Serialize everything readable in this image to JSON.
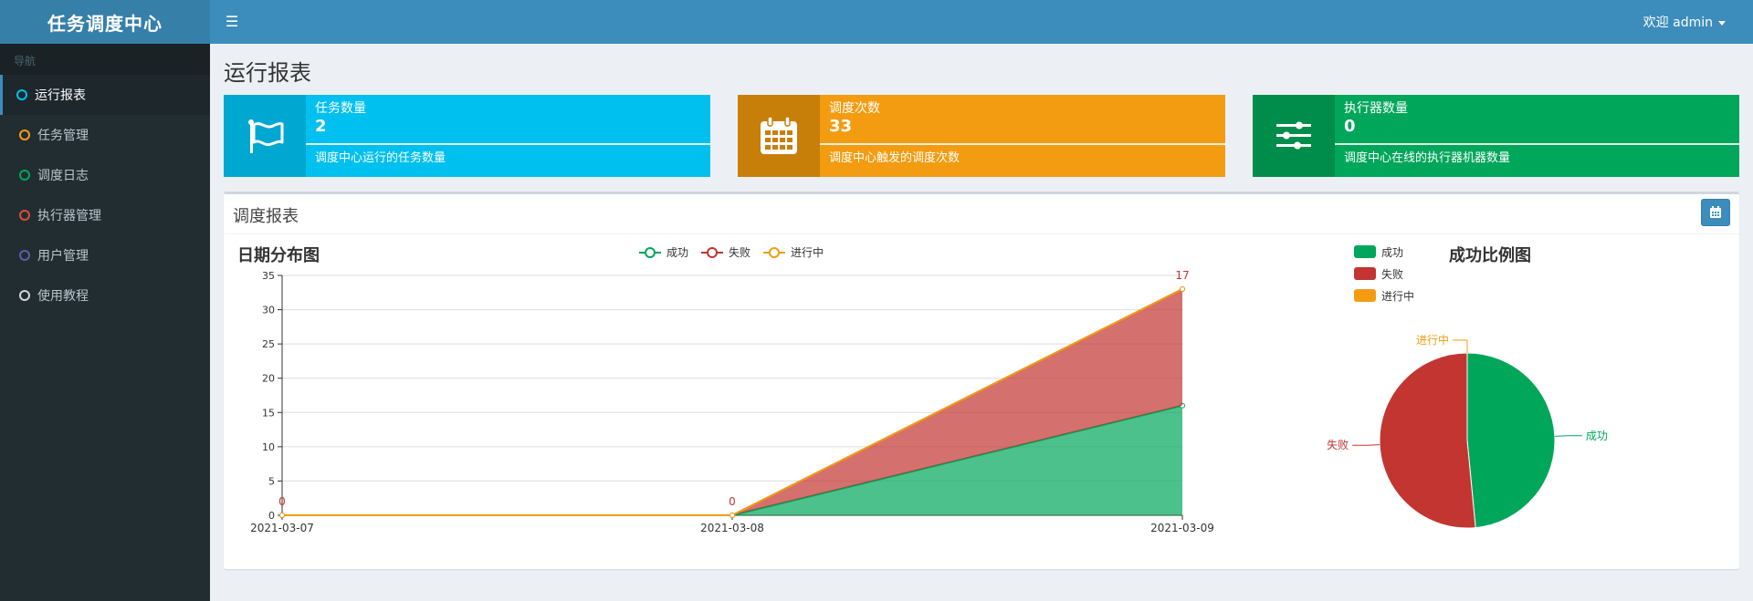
{
  "app": {
    "title": "任务调度中心",
    "user_menu": "欢迎 admin"
  },
  "sidebar": {
    "header": "导航",
    "items": [
      {
        "label": "运行报表",
        "color": "#00c0ef",
        "active": true
      },
      {
        "label": "任务管理",
        "color": "#f39c12",
        "active": false
      },
      {
        "label": "调度日志",
        "color": "#00a65a",
        "active": false
      },
      {
        "label": "执行器管理",
        "color": "#dd4b39",
        "active": false
      },
      {
        "label": "用户管理",
        "color": "#605ca8",
        "active": false
      },
      {
        "label": "使用教程",
        "color": "#d2d6de",
        "active": false
      }
    ]
  },
  "page": {
    "title": "运行报表"
  },
  "info_boxes": [
    {
      "label": "任务数量",
      "value": "2",
      "desc": "调度中心运行的任务数量",
      "icon": "flag-icon",
      "bg": "#00c0ef",
      "icon_bg": "#00a7d0"
    },
    {
      "label": "调度次数",
      "value": "33",
      "desc": "调度中心触发的调度次数",
      "icon": "calendar-icon",
      "bg": "#f39c12",
      "icon_bg": "#c87f0a"
    },
    {
      "label": "执行器数量",
      "value": "0",
      "desc": "调度中心在线的执行器机器数量",
      "icon": "sliders-icon",
      "bg": "#00a65a",
      "icon_bg": "#008d4c"
    }
  ],
  "report_panel": {
    "title": "调度报表",
    "date_button_icon": "calendar-icon"
  },
  "chart_data": [
    {
      "type": "area",
      "title": "日期分布图",
      "stacked": true,
      "categories": [
        "2021-03-07",
        "2021-03-08",
        "2021-03-09"
      ],
      "series": [
        {
          "name": "成功",
          "values": [
            0,
            0,
            16
          ],
          "color": "#00a65a"
        },
        {
          "name": "失败",
          "values": [
            0,
            0,
            17
          ],
          "color": "#c23531"
        },
        {
          "name": "进行中",
          "values": [
            0,
            0,
            0
          ],
          "color": "#f39c12"
        }
      ],
      "data_labels": [
        "0",
        "0",
        "17"
      ],
      "yticks": [
        0,
        5,
        10,
        15,
        20,
        25,
        30,
        35
      ],
      "ylim": [
        0,
        35
      ],
      "grid": true,
      "legend": "top-center"
    },
    {
      "type": "pie",
      "title": "成功比例图",
      "slices": [
        {
          "name": "成功",
          "value": 16,
          "color": "#00a65a"
        },
        {
          "name": "失败",
          "value": 17,
          "color": "#c23531"
        },
        {
          "name": "进行中",
          "value": 0,
          "color": "#f39c12"
        }
      ],
      "legend": "top-left"
    }
  ]
}
